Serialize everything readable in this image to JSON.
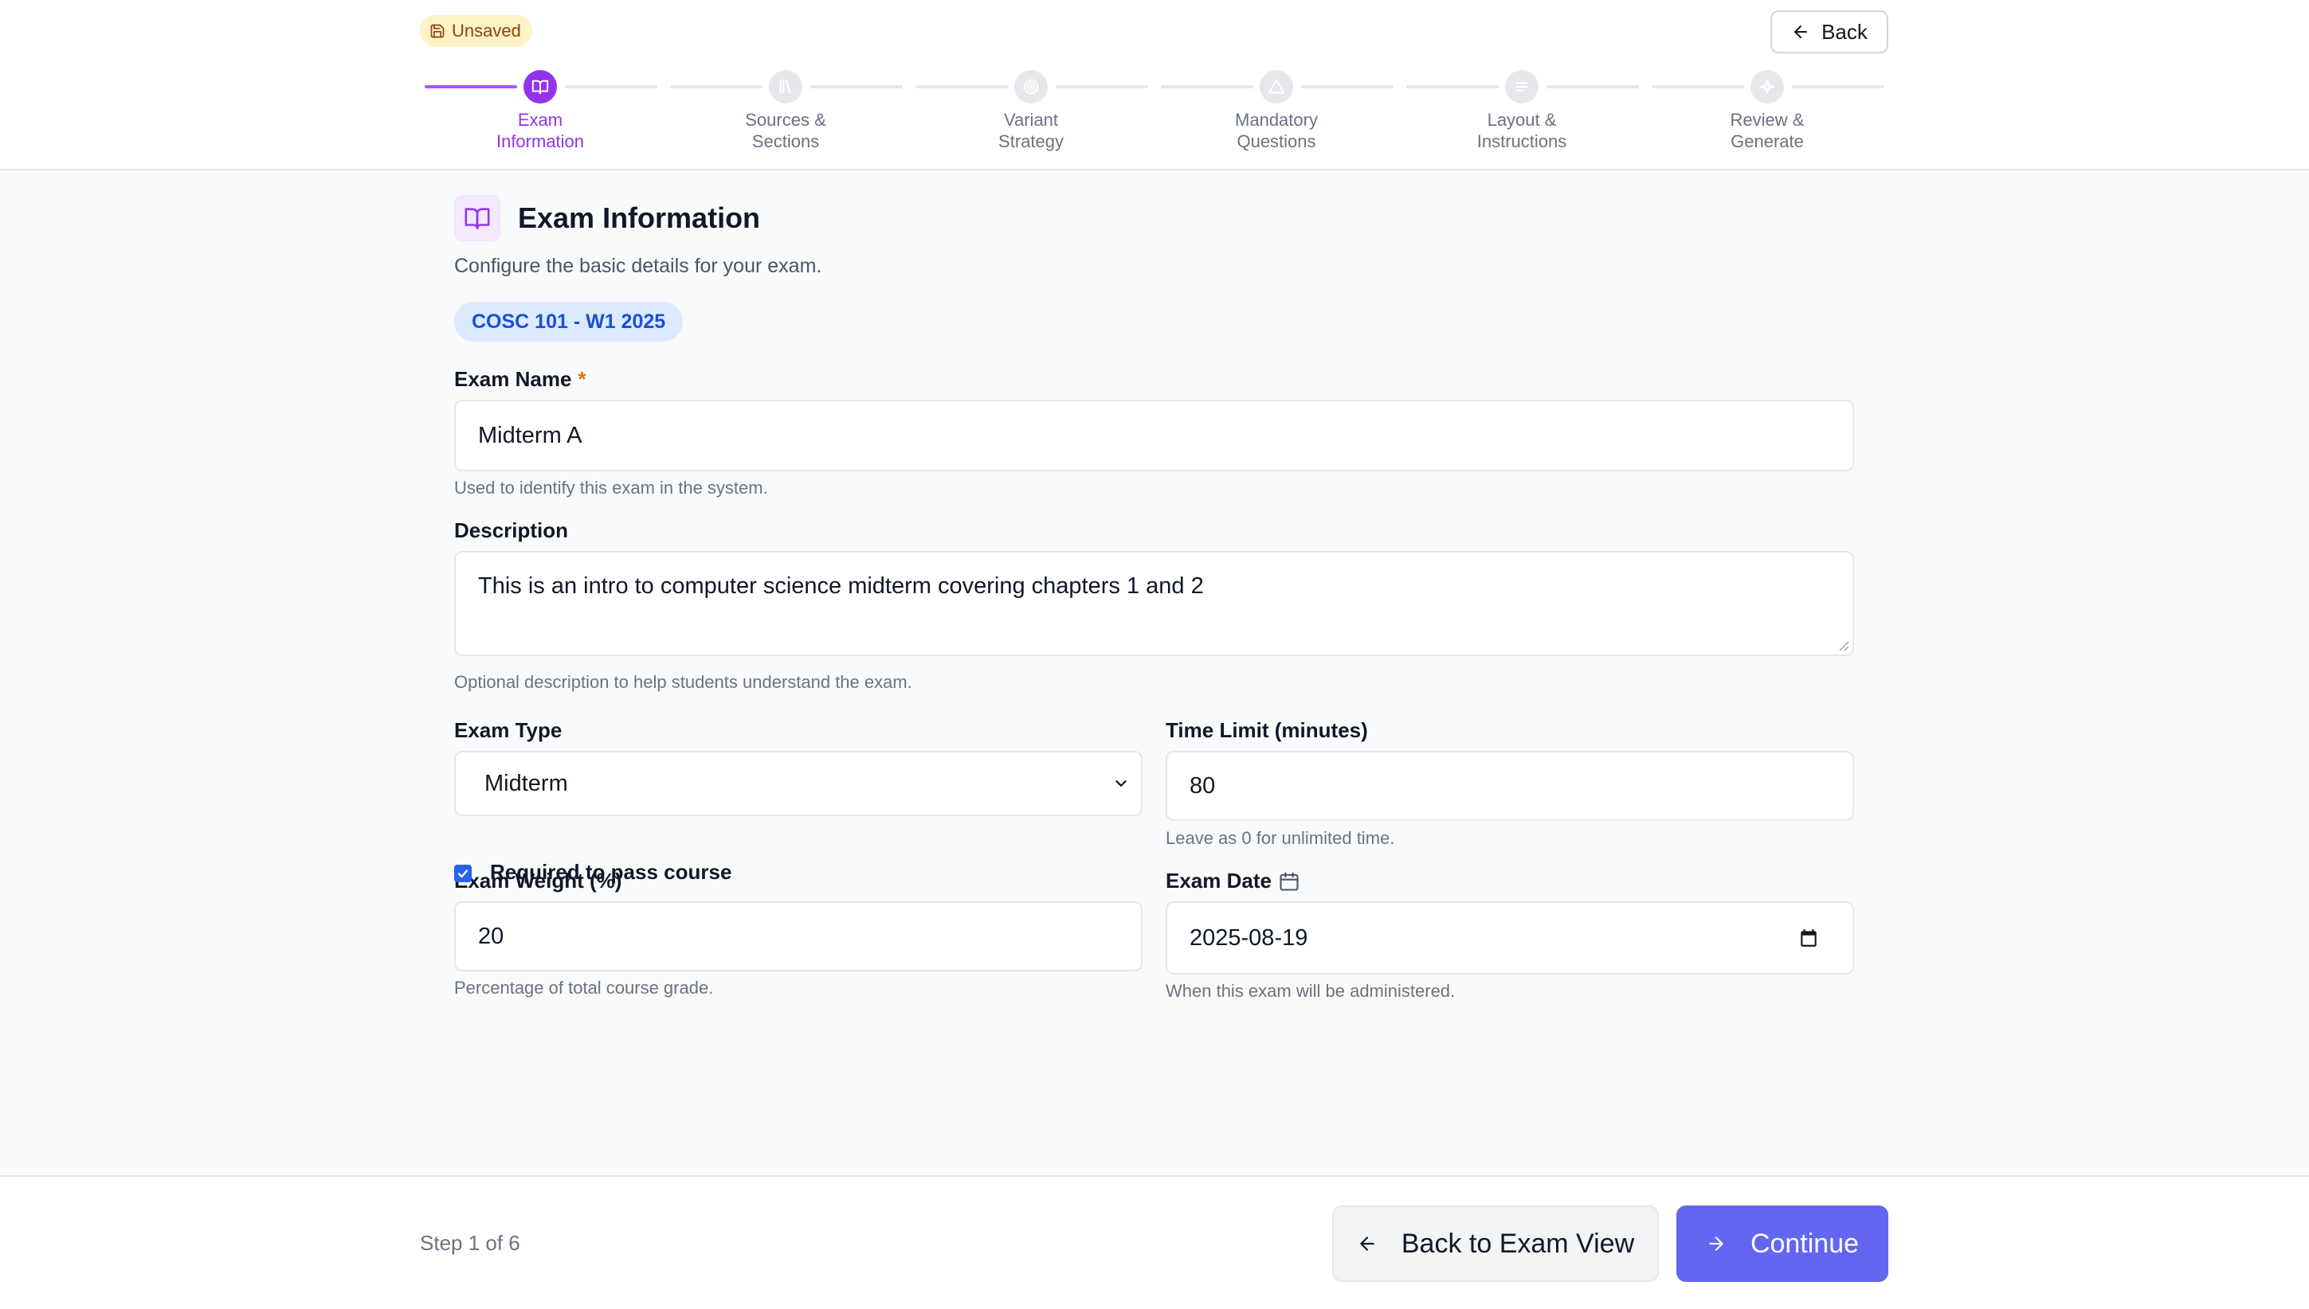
{
  "header": {
    "unsaved_label": "Unsaved",
    "back_label": "Back"
  },
  "stepper": {
    "steps": [
      {
        "line1": "Exam",
        "line2": "Information",
        "icon": "book-open-icon",
        "state": "active"
      },
      {
        "line1": "Sources &",
        "line2": "Sections",
        "icon": "library-icon",
        "state": "pending"
      },
      {
        "line1": "Variant",
        "line2": "Strategy",
        "icon": "target-icon",
        "state": "pending"
      },
      {
        "line1": "Mandatory",
        "line2": "Questions",
        "icon": "triangle-alert-icon",
        "state": "pending"
      },
      {
        "line1": "Layout &",
        "line2": "Instructions",
        "icon": "list-icon",
        "state": "pending"
      },
      {
        "line1": "Review &",
        "line2": "Generate",
        "icon": "sparkle-icon",
        "state": "pending"
      }
    ]
  },
  "main": {
    "title": "Exam Information",
    "subtitle": "Configure the basic details for your exam.",
    "course_badge": "COSC 101 - W1 2025",
    "exam_name": {
      "label": "Exam Name",
      "required_marker": "*",
      "value": "Midterm A",
      "help": "Used to identify this exam in the system."
    },
    "description": {
      "label": "Description",
      "value": "This is an intro to computer science midterm covering chapters 1 and 2",
      "help": "Optional description to help students understand the exam."
    },
    "exam_type": {
      "label": "Exam Type",
      "value": "Midterm"
    },
    "time_limit": {
      "label": "Time Limit (minutes)",
      "value": "80",
      "help": "Leave as 0 for unlimited time."
    },
    "exam_weight": {
      "label": "Exam Weight (%)",
      "value": "20",
      "help": "Percentage of total course grade."
    },
    "exam_date": {
      "label": "Exam Date",
      "value": "2025-08-19",
      "help": "When this exam will be administered."
    },
    "required_to_pass": {
      "label": "Required to pass course",
      "checked": true
    }
  },
  "footer": {
    "step_text": "Step 1 of 6",
    "back_button": "Back to Exam View",
    "continue_button": "Continue"
  },
  "colors": {
    "accent_purple": "#9333ea",
    "primary_indigo": "#6366f1",
    "badge_blue_bg": "#dbeafe",
    "badge_blue_text": "#1d4ed8",
    "unsaved_bg": "#fef3c7",
    "checkbox_blue": "#2563eb"
  }
}
